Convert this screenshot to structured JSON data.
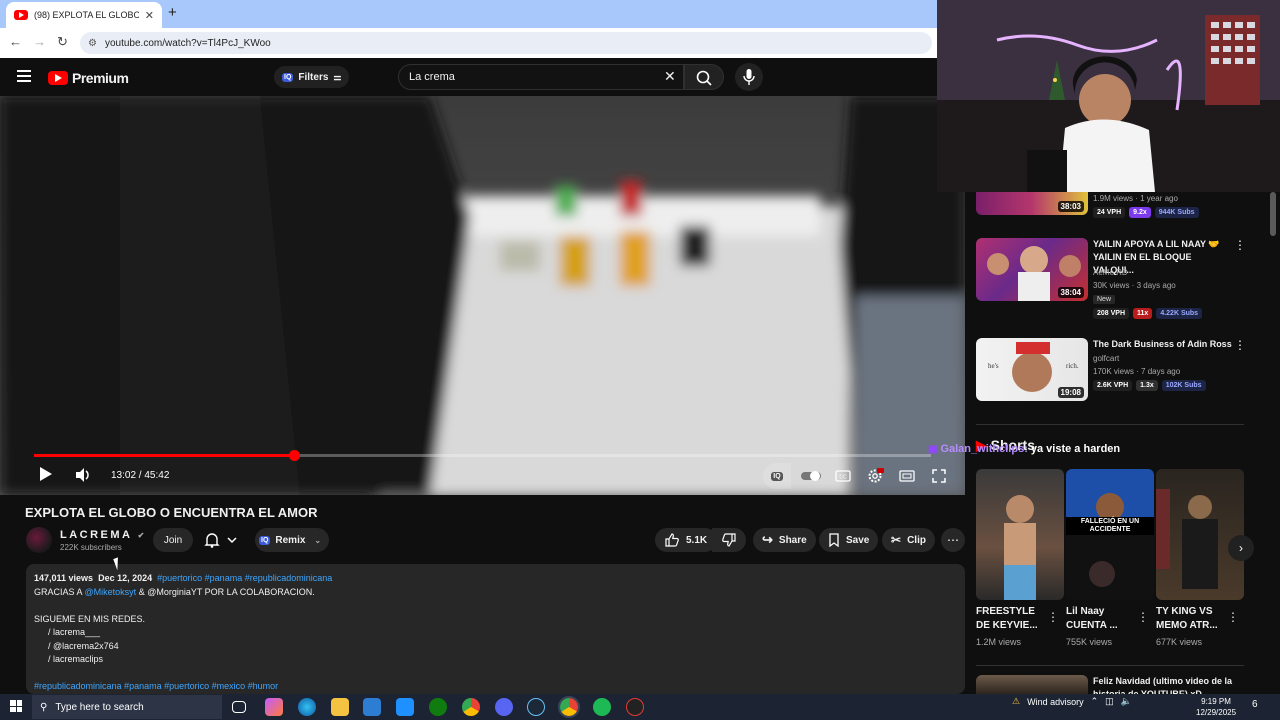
{
  "browser": {
    "tab_title": "(98) EXPLOTA EL GLOBO O E",
    "new_tab": "+",
    "url": "youtube.com/watch?v=Tl4PcJ_KWoo"
  },
  "header": {
    "logo_text": "Premium",
    "filters_label": "Filters",
    "iq_badge": "IQ",
    "search_value": "La crema"
  },
  "player": {
    "progress": 0.29,
    "timecode": "13:02 / 45:42"
  },
  "video": {
    "title": "EXPLOTA EL GLOBO O ENCUENTRA EL AMOR",
    "channel_name": "LACREMA",
    "subscribers": "222K subscribers",
    "join_label": "Join",
    "remix_label": "Remix",
    "likes": "5.1K",
    "share_label": "Share",
    "save_label": "Save",
    "clip_label": "Clip"
  },
  "description": {
    "views": "147,011 views",
    "date": "Dec 12, 2024",
    "hashtags_top": "#puertorico #panama #republicadominicana",
    "line1_pre": "GRACIAS A ",
    "line1_link": "@Miketoksyt",
    "line1_post": "  & @MorginiaYT POR LA COLABORACION.",
    "line2": "SIGUEME EN MIS REDES.",
    "social1": "/ lacrema___",
    "social2": "/ @lacrema2x764",
    "social3": "/ lacremaclips",
    "hashtags_bottom": "#republicadominicana #panama #puertorico #mexico #humor"
  },
  "recommendations": [
    {
      "title": "",
      "channel": "",
      "meta": "1.9M views · 1 year ago",
      "duration": "38:03",
      "vph": "24 VPH",
      "mult": "9.2x",
      "subs": "944K Subs",
      "is_new": false
    },
    {
      "title": "YAILIN APOYA A LIL NAAY 🤝 YAILIN EN EL BLOQUE VALQUI...",
      "channel": "AeMe RD",
      "meta": "30K views · 3 days ago",
      "duration": "38:04",
      "new_label": "New",
      "vph": "208 VPH",
      "mult": "11x",
      "subs": "4.22K Subs"
    },
    {
      "title": "The Dark Business of Adin Ross",
      "channel": "golfcart",
      "meta": "170K views · 7 days ago",
      "duration": "19:08",
      "vph": "2.6K VPH",
      "mult": "1.3x",
      "subs": "102K Subs"
    }
  ],
  "overlay_chat": {
    "user": "Galan_withclips:",
    "message": "ya viste a harden"
  },
  "shorts": {
    "heading": "Shorts",
    "items": [
      {
        "title": "FREESTYLE DE KEYVIE...",
        "views": "1.2M views"
      },
      {
        "title": "Lil Naay CUENTA ...",
        "views": "755K views",
        "thumb_text": "FALLECIÓ EN UN ACCIDENTE"
      },
      {
        "title": "TY KING VS MEMO ATR...",
        "views": "677K views"
      }
    ]
  },
  "last_rec": {
    "title": "Feliz Navidad (ultimo video de la historia de YOUTUBE) xD"
  },
  "taskbar": {
    "search_placeholder": "Type here to search",
    "weather": "Wind advisory",
    "time": "9:19 PM",
    "date": "12/29/2025",
    "notif_count": "6"
  },
  "colors": {
    "accent_red": "#ff0000",
    "link_blue": "#3ea6ff"
  }
}
